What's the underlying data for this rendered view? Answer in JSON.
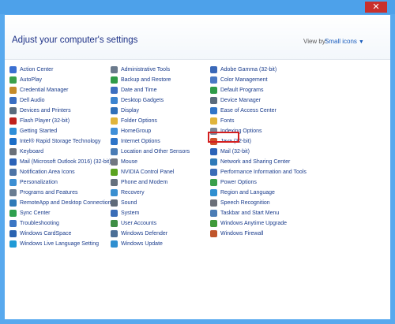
{
  "window": {
    "close_label": "✕"
  },
  "header": {
    "title": "Adjust your computer's settings",
    "viewby_label": "View by:",
    "viewby_value": "Small icons"
  },
  "columns": [
    [
      {
        "label": "Action Center",
        "icon": "flag-icon",
        "color": "#3b6fd1"
      },
      {
        "label": "AutoPlay",
        "icon": "autoplay-icon",
        "color": "#3aa04a"
      },
      {
        "label": "Credential Manager",
        "icon": "credential-icon",
        "color": "#c58b2a"
      },
      {
        "label": "Dell Audio",
        "icon": "audio-icon",
        "color": "#3a6ec2"
      },
      {
        "label": "Devices and Printers",
        "icon": "printer-icon",
        "color": "#5a6b7c"
      },
      {
        "label": "Flash Player (32-bit)",
        "icon": "flash-icon",
        "color": "#c0211c"
      },
      {
        "label": "Getting Started",
        "icon": "getting-started-icon",
        "color": "#2f8fd8"
      },
      {
        "label": "Intel® Rapid Storage Technology",
        "icon": "intel-icon",
        "color": "#1d6ec7"
      },
      {
        "label": "Keyboard",
        "icon": "keyboard-icon",
        "color": "#6b7078"
      },
      {
        "label": "Mail (Microsoft Outlook 2016) (32-bit)",
        "icon": "mail-icon",
        "color": "#2b63b8"
      },
      {
        "label": "Notification Area Icons",
        "icon": "notification-icon",
        "color": "#4d74a6"
      },
      {
        "label": "Personalization",
        "icon": "personalization-icon",
        "color": "#3c8fd3"
      },
      {
        "label": "Programs and Features",
        "icon": "programs-icon",
        "color": "#6a7d91"
      },
      {
        "label": "RemoteApp and Desktop Connections",
        "icon": "remote-icon",
        "color": "#2f7ab8"
      },
      {
        "label": "Sync Center",
        "icon": "sync-icon",
        "color": "#2fa04e"
      },
      {
        "label": "Troubleshooting",
        "icon": "troubleshoot-icon",
        "color": "#3a76c4"
      },
      {
        "label": "Windows CardSpace",
        "icon": "cardspace-icon",
        "color": "#2a63b0"
      },
      {
        "label": "Windows Live Language Setting",
        "icon": "language-icon",
        "color": "#1f9ad6"
      }
    ],
    [
      {
        "label": "Administrative Tools",
        "icon": "admin-tools-icon",
        "color": "#6b7a8c"
      },
      {
        "label": "Backup and Restore",
        "icon": "backup-icon",
        "color": "#2f9b47"
      },
      {
        "label": "Date and Time",
        "icon": "clock-icon",
        "color": "#3d6fc0"
      },
      {
        "label": "Desktop Gadgets",
        "icon": "gadgets-icon",
        "color": "#3c84cf"
      },
      {
        "label": "Display",
        "icon": "display-icon",
        "color": "#2f6fb8"
      },
      {
        "label": "Folder Options",
        "icon": "folder-icon",
        "color": "#e0b43a"
      },
      {
        "label": "HomeGroup",
        "icon": "homegroup-icon",
        "color": "#3f8fd8"
      },
      {
        "label": "Internet Options",
        "icon": "internet-icon",
        "color": "#2d74c8"
      },
      {
        "label": "Location and Other Sensors",
        "icon": "location-icon",
        "color": "#4a7cb5"
      },
      {
        "label": "Mouse",
        "icon": "mouse-icon",
        "color": "#717680"
      },
      {
        "label": "NVIDIA Control Panel",
        "icon": "nvidia-icon",
        "color": "#5ba31f"
      },
      {
        "label": "Phone and Modem",
        "icon": "phone-icon",
        "color": "#66717d"
      },
      {
        "label": "Recovery",
        "icon": "recovery-icon",
        "color": "#3a8fd0"
      },
      {
        "label": "Sound",
        "icon": "sound-icon",
        "color": "#5f6a78"
      },
      {
        "label": "System",
        "icon": "system-icon",
        "color": "#3a6db7"
      },
      {
        "label": "User Accounts",
        "icon": "user-icon",
        "color": "#3f8e45"
      },
      {
        "label": "Windows Defender",
        "icon": "defender-icon",
        "color": "#4c6f96"
      },
      {
        "label": "Windows Update",
        "icon": "update-icon",
        "color": "#2f8fd0"
      }
    ],
    [
      {
        "label": "Adobe Gamma (32-bit)",
        "icon": "adobe-gamma-icon",
        "color": "#3a68b8"
      },
      {
        "label": "Color Management",
        "icon": "color-icon",
        "color": "#4a79c4"
      },
      {
        "label": "Default Programs",
        "icon": "default-programs-icon",
        "color": "#2f9b47"
      },
      {
        "label": "Device Manager",
        "icon": "device-manager-icon",
        "color": "#5a6b7c"
      },
      {
        "label": "Ease of Access Center",
        "icon": "ease-access-icon",
        "color": "#2f74c8"
      },
      {
        "label": "Fonts",
        "icon": "fonts-icon",
        "color": "#e0b43a"
      },
      {
        "label": "Indexing Options",
        "icon": "indexing-icon",
        "color": "#7a8796"
      },
      {
        "label": "Java (32-bit)",
        "icon": "java-icon",
        "color": "#d0512a"
      },
      {
        "label": "Mail (32-bit)",
        "icon": "mail-icon",
        "color": "#2b63b8"
      },
      {
        "label": "Network and Sharing Center",
        "icon": "network-icon",
        "color": "#2f7ab8"
      },
      {
        "label": "Performance Information and Tools",
        "icon": "performance-icon",
        "color": "#3a6db7"
      },
      {
        "label": "Power Options",
        "icon": "power-icon",
        "color": "#3aa04a"
      },
      {
        "label": "Region and Language",
        "icon": "region-icon",
        "color": "#2f8fd0"
      },
      {
        "label": "Speech Recognition",
        "icon": "speech-icon",
        "color": "#6b7078"
      },
      {
        "label": "Taskbar and Start Menu",
        "icon": "taskbar-icon",
        "color": "#4a7cb5"
      },
      {
        "label": "Windows Anytime Upgrade",
        "icon": "anytime-upgrade-icon",
        "color": "#3f9a3a"
      },
      {
        "label": "Windows Firewall",
        "icon": "firewall-icon",
        "color": "#c0552a"
      }
    ]
  ]
}
